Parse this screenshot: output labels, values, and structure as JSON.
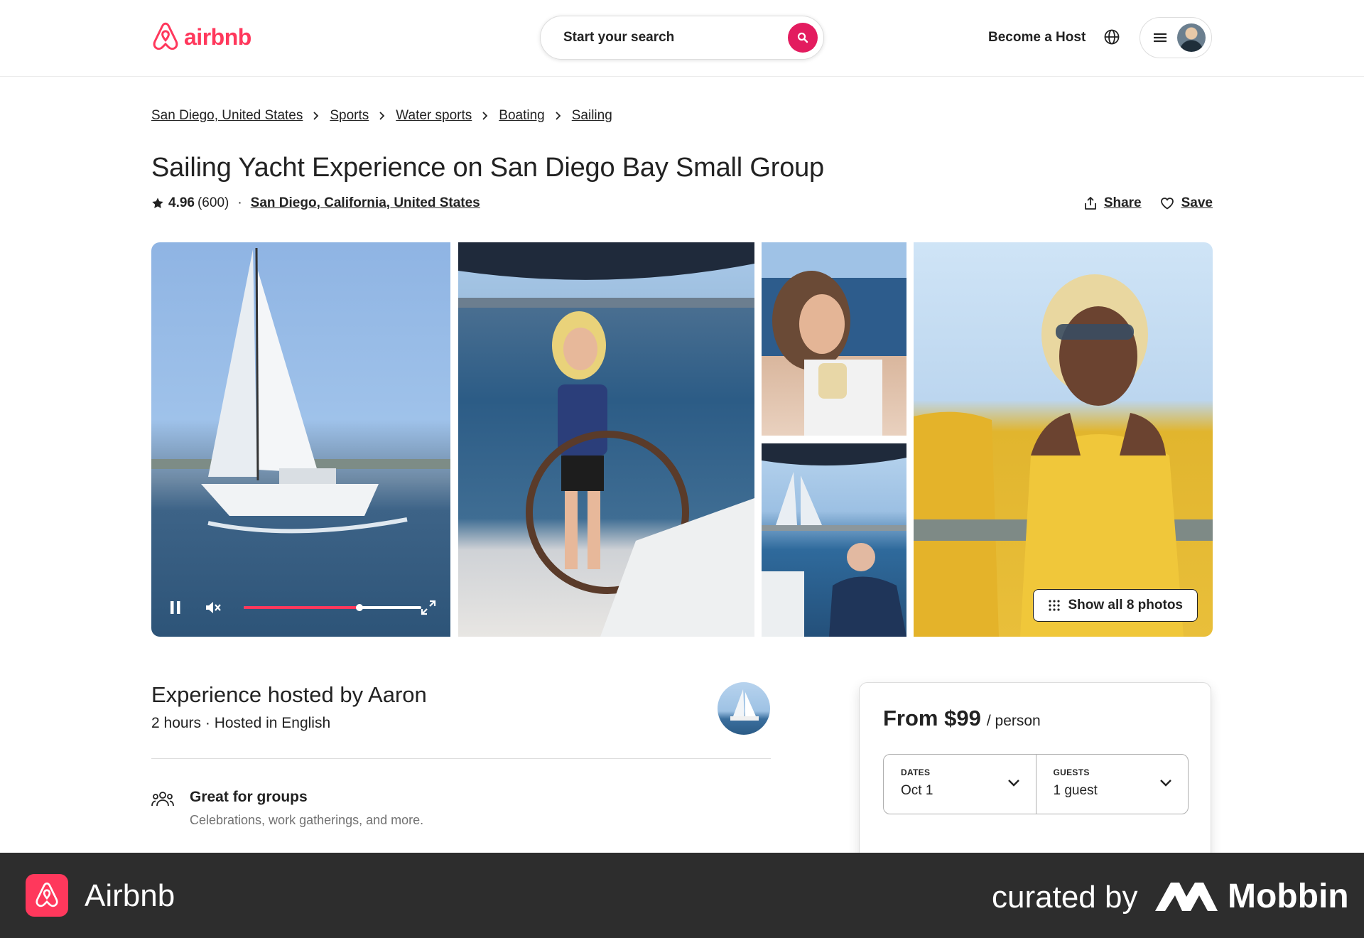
{
  "header": {
    "logo_text": "airbnb",
    "search_placeholder": "Start your search",
    "become_host": "Become a Host"
  },
  "breadcrumb": [
    "San Diego, United States",
    "Sports",
    "Water sports",
    "Boating",
    "Sailing"
  ],
  "listing": {
    "title": "Sailing Yacht Experience on San Diego Bay Small Group",
    "rating": "4.96",
    "reviews": "(600)",
    "separator": "·",
    "location": "San Diego, California, United States",
    "share_label": "Share",
    "save_label": "Save"
  },
  "gallery": {
    "show_all_label": "Show all 8 photos",
    "video_progress": 0.65
  },
  "host": {
    "title": "Experience hosted by Aaron",
    "subtitle": "2 hours · Hosted in English"
  },
  "feature": {
    "title": "Great for groups",
    "subtitle": "Celebrations, work gatherings, and more."
  },
  "booking": {
    "price": "From $99",
    "unit": "/ person",
    "dates_label": "DATES",
    "dates_value": "Oct 1",
    "guests_label": "GUESTS",
    "guests_value": "1 guest"
  },
  "footer": {
    "app_name": "Airbnb",
    "curated_by": "curated by",
    "brand": "Mobbin"
  },
  "colors": {
    "brand": "#FF385C",
    "search_button": "#E31C5F",
    "footer_bg": "#2d2d2d"
  }
}
